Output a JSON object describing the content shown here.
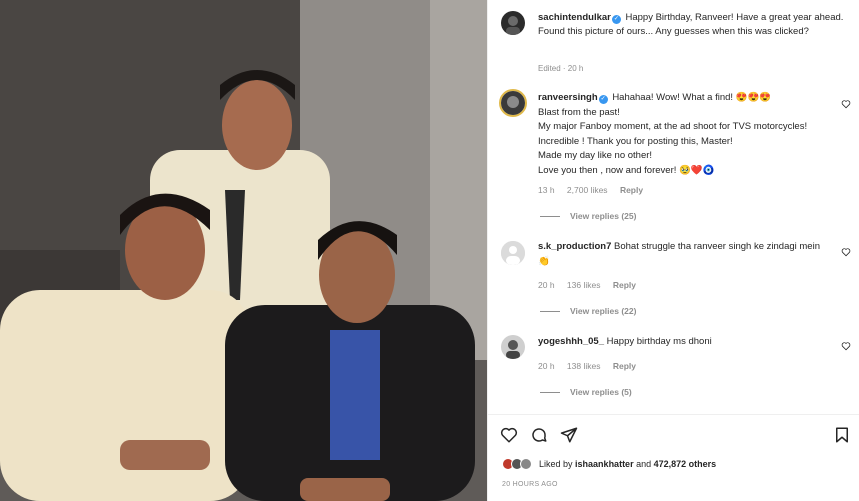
{
  "post_author": {
    "username": "sachintendulkar",
    "caption_line1": "Happy Birthday, Ranveer! Have a great year ahead.",
    "caption_line2": "Found this picture of ours... Any guesses when this was clicked?",
    "edited": "Edited · 20 h"
  },
  "comments": [
    {
      "username": "ranveersingh",
      "verified": true,
      "text_lines": [
        "Hahahaa! Wow! What a find! 😍😍😍",
        "Blast from the past!",
        "My major Fanboy moment, at the ad shoot for TVS motorcycles! Incredible ! Thank you for posting this, Master!",
        "Made my day like no other!",
        "Love you then , now and forever! 🥹❤️🧿"
      ],
      "time": "13 h",
      "likes": "2,700 likes",
      "reply": "Reply",
      "view_replies": "View replies (25)"
    },
    {
      "username": "s.k_production7",
      "text": "Bohat struggle tha ranveer singh ke zindagi mein👏",
      "time": "20 h",
      "likes": "136 likes",
      "reply": "Reply",
      "view_replies": "View replies (22)"
    },
    {
      "username": "yogeshhh_05_",
      "text": "Happy birthday ms dhoni",
      "time": "20 h",
      "likes": "138 likes",
      "reply": "Reply",
      "view_replies": "View replies (5)"
    }
  ],
  "likes": {
    "prefix": "Liked by",
    "user": "ishaankhatter",
    "conjunction": "and",
    "count": "472,872 others"
  },
  "timestamp": "20 HOURS AGO",
  "icons": {
    "like": "heart-icon",
    "comment": "comment-icon",
    "share": "share-icon",
    "save": "bookmark-icon",
    "verified": "verified-badge-icon"
  },
  "colors": {
    "verified": "#3897f0",
    "muted": "#8e8e8e",
    "text": "#262626"
  }
}
